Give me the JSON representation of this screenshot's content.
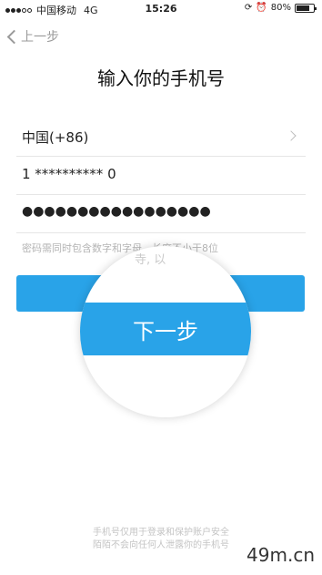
{
  "status_bar": {
    "carrier": "中国移动",
    "network": "4G",
    "time": "15:26",
    "battery_percent": "80%",
    "battery_level": 0.8
  },
  "nav": {
    "back_label": "上一步"
  },
  "title": "输入你的手机号",
  "form": {
    "country": "中国(+86)",
    "phone": "1 ********** 0",
    "password_masked": "●●●●●●●●●●●●●●●●●",
    "hint": "密码需同时包含数字和字母，长度不小于8位"
  },
  "next_button": {
    "label": "下一步",
    "color": "#29a3e8"
  },
  "magnifier": {
    "faint_text": "寺, 以"
  },
  "footer": {
    "line1": "手机号仅用于登录和保护账户安全",
    "line2": "陌陌不会向任何人泄露你的手机号"
  },
  "watermark": "49m.cn"
}
